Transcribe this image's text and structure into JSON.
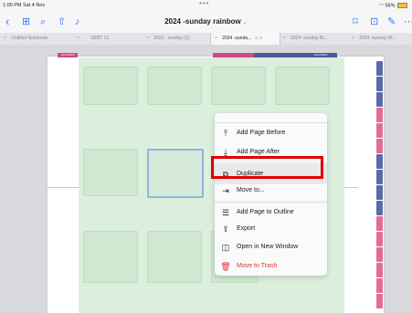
{
  "status_bar": {
    "time_date": "1:00 PM  Sat 4 Nov",
    "dots": "•••",
    "battery": "56%"
  },
  "toolbar": {
    "title": "2024 -sunday rainbow",
    "title_chevron": "⌄",
    "left_icons": [
      "chevron-left-icon",
      "grid-icon",
      "search-icon",
      "share-icon",
      "microphone-icon"
    ],
    "right_icons": [
      "bookmark-icon",
      "add-page-icon",
      "pen-icon",
      "more-icon"
    ]
  },
  "tabs": [
    {
      "label": "Untitled Notebook",
      "active": false
    },
    {
      "label": "SEBT 12",
      "active": false
    },
    {
      "label": "2023 - sunday (1)",
      "active": false
    },
    {
      "label": "2024 -sunda...",
      "active": true
    },
    {
      "label": "2024 -sunday Bl...",
      "active": false
    },
    {
      "label": "2024 -sunday Bl...",
      "active": false
    }
  ],
  "page": {
    "top_tab_left": "VACATION",
    "top_tab_right": "VACATION",
    "side_tab_colors": [
      "#5a6aa8",
      "#5a6aa8",
      "#5a6aa8",
      "#e46b93",
      "#e46b93",
      "#e46b93",
      "#5a6aa8",
      "#5a6aa8",
      "#5a6aa8",
      "#5a6aa8",
      "#e46b93",
      "#e46b93",
      "#e46b93",
      "#e46b93",
      "#e46b93",
      "#e46b93"
    ]
  },
  "context_menu": {
    "items": [
      {
        "label": "Add Page Before",
        "icon": "add-page-before-icon",
        "glyph": "⤒",
        "separator": false,
        "destructive": false
      },
      {
        "label": "Add Page After",
        "icon": "add-page-after-icon",
        "glyph": "⤓",
        "separator": false,
        "destructive": false
      },
      {
        "label": "Duplicate",
        "icon": "duplicate-icon",
        "glyph": "⧉",
        "separator": true,
        "destructive": false
      },
      {
        "label": "Move to...",
        "icon": "move-to-icon",
        "glyph": "⇥",
        "separator": false,
        "destructive": false
      },
      {
        "label": "Add Page to Outline",
        "icon": "outline-icon",
        "glyph": "☰",
        "separator": true,
        "destructive": false
      },
      {
        "label": "Export",
        "icon": "export-icon",
        "glyph": "⇪",
        "separator": false,
        "destructive": false
      },
      {
        "label": "Open in New Window",
        "icon": "new-window-icon",
        "glyph": "◫",
        "separator": false,
        "destructive": false
      },
      {
        "label": "Move to Trash",
        "icon": "trash-icon",
        "glyph": "🗑",
        "separator": false,
        "destructive": true
      }
    ]
  },
  "colors": {
    "accent": "#3478f6",
    "highlight": "#e00000",
    "destructive": "#e0323a"
  }
}
